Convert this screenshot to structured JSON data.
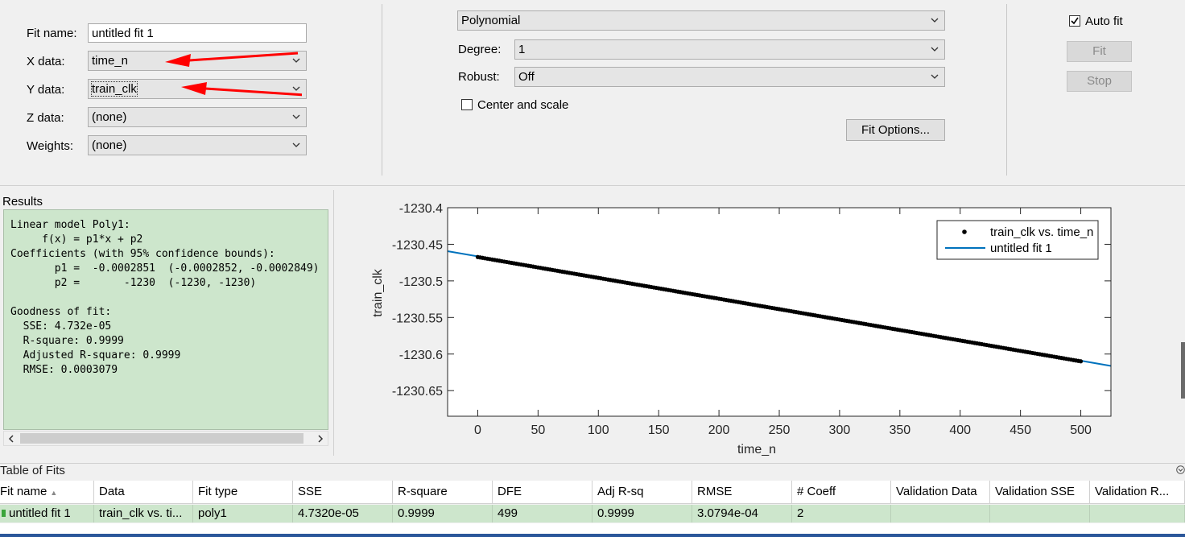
{
  "data_panel": {
    "fit_name_label": "Fit name:",
    "fit_name_value": "untitled fit 1",
    "x_label": "X data:",
    "x_value": "time_n",
    "y_label": "Y data:",
    "y_value": "train_clk",
    "z_label": "Z data:",
    "z_value": "(none)",
    "weights_label": "Weights:",
    "weights_value": "(none)"
  },
  "fit_panel": {
    "fit_type": "Polynomial",
    "degree_label": "Degree:",
    "degree_value": "1",
    "robust_label": "Robust:",
    "robust_value": "Off",
    "center_scale_label": "Center and scale",
    "center_scale_checked": false,
    "fit_options_button": "Fit Options..."
  },
  "action_panel": {
    "auto_fit_label": "Auto fit",
    "auto_fit_checked": true,
    "fit_button": "Fit",
    "stop_button": "Stop"
  },
  "results": {
    "title": "Results",
    "text": "Linear model Poly1:\n     f(x) = p1*x + p2\nCoefficients (with 95% confidence bounds):\n       p1 =  -0.0002851  (-0.0002852, -0.0002849)\n       p2 =       -1230  (-1230, -1230)\n\nGoodness of fit:\n  SSE: 4.732e-05\n  R-square: 0.9999\n  Adjusted R-square: 0.9999\n  RMSE: 0.0003079"
  },
  "chart_data": {
    "type": "scatter",
    "xlabel": "time_n",
    "ylabel": "train_clk",
    "xlim": [
      -25,
      525
    ],
    "ylim": [
      -1230.685,
      -1230.4
    ],
    "xticks": [
      0,
      50,
      100,
      150,
      200,
      250,
      300,
      350,
      400,
      450,
      500
    ],
    "yticks": [
      -1230.4,
      -1230.45,
      -1230.5,
      -1230.55,
      -1230.6,
      -1230.65
    ],
    "ytick_labels": [
      "-1230.4",
      "-1230.45",
      "-1230.5",
      "-1230.55",
      "-1230.6",
      "-1230.65"
    ],
    "series": [
      {
        "name": "train_clk vs. time_n",
        "kind": "points",
        "color": "#000000",
        "x_range": [
          0,
          500
        ],
        "slope": -0.0002851,
        "intercept": -1230.4665
      },
      {
        "name": "untitled fit 1",
        "kind": "line",
        "color": "#0072bd",
        "slope": -0.0002851,
        "intercept": -1230.4665
      }
    ],
    "legend_position": "top-right",
    "grid": false
  },
  "table": {
    "title": "Table of Fits",
    "columns": [
      "Fit name",
      "Data",
      "Fit type",
      "SSE",
      "R-square",
      "DFE",
      "Adj R-sq",
      "RMSE",
      "# Coeff",
      "Validation Data",
      "Validation SSE",
      "Validation R..."
    ],
    "rows": [
      [
        "untitled fit 1",
        "train_clk vs. ti...",
        "poly1",
        "4.7320e-05",
        "0.9999",
        "499",
        "0.9999",
        "3.0794e-04",
        "2",
        "",
        "",
        ""
      ]
    ]
  },
  "colors": {
    "results_bg": "#cde6cc",
    "fit_line": "#0072bd",
    "annotation_arrow": "#ff0000",
    "row_highlight": "#cde6cc"
  }
}
